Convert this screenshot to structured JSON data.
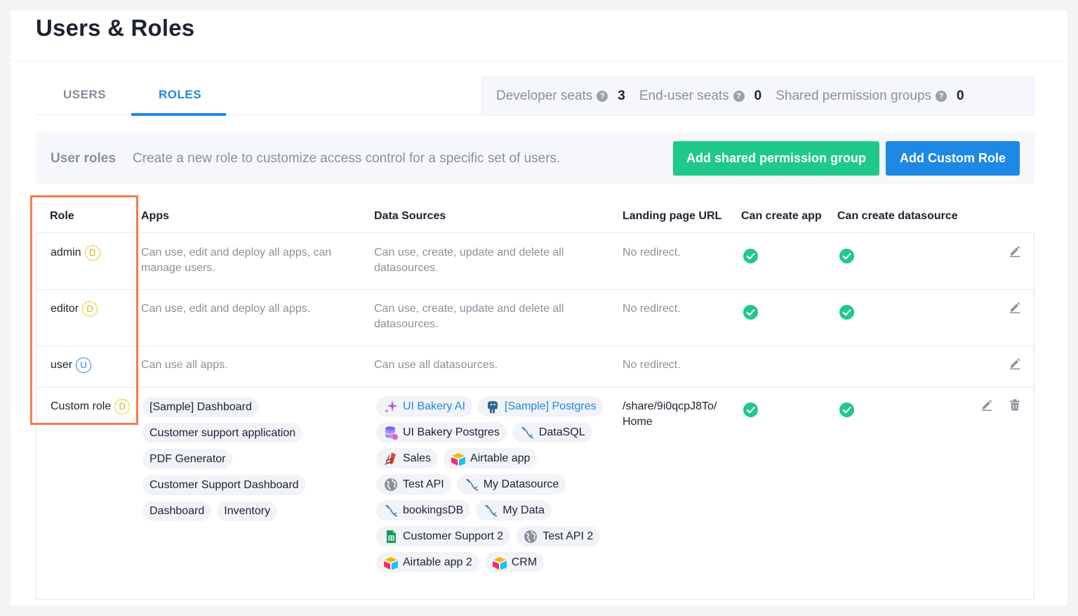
{
  "page": {
    "title": "Users & Roles"
  },
  "tabs": [
    {
      "label": "USERS",
      "active": false
    },
    {
      "label": "ROLES",
      "active": true
    }
  ],
  "seats": {
    "developer": {
      "label": "Developer seats",
      "value": "3"
    },
    "end_user": {
      "label": "End-user seats",
      "value": "0"
    },
    "shared_groups": {
      "label": "Shared permission groups",
      "value": "0"
    },
    "help_glyph": "?"
  },
  "roles_bar": {
    "title": "User roles",
    "description": "Create a new role to customize access control for a specific set of users.",
    "add_group_label": "Add shared permission group",
    "add_role_label": "Add Custom Role"
  },
  "table": {
    "headers": {
      "role": "Role",
      "apps": "Apps",
      "data_sources": "Data Sources",
      "landing": "Landing page URL",
      "can_create_app": "Can create app",
      "can_create_datasource": "Can create datasource"
    },
    "rows": [
      {
        "name": "admin",
        "badge": "D",
        "apps": "Can use, edit and deploy all apps, can manage users.",
        "data_sources": "Can use, create, update and delete all datasources.",
        "landing": "No redirect.",
        "can_create_app": true,
        "can_create_datasource": true
      },
      {
        "name": "editor",
        "badge": "D",
        "apps": "Can use, edit and deploy all apps.",
        "data_sources": "Can use, create, update and delete all datasources.",
        "landing": "No redirect.",
        "can_create_app": true,
        "can_create_datasource": true
      },
      {
        "name": "user",
        "badge": "U",
        "apps": "Can use all apps.",
        "data_sources": "Can use all datasources.",
        "landing": "No redirect.",
        "can_create_app": false,
        "can_create_datasource": false
      },
      {
        "name": "Custom role",
        "badge": "D",
        "apps_list": [
          "[Sample] Dashboard",
          "Customer support application",
          "PDF Generator",
          "Customer Support Dashboard",
          "Dashboard",
          "Inventory"
        ],
        "data_sources_list": [
          {
            "label": "UI Bakery AI",
            "icon": "ai-sparkle-icon"
          },
          {
            "label": "[Sample] Postgres",
            "icon": "postgres-icon"
          },
          {
            "label": "UI Bakery Postgres",
            "icon": "database-icon"
          },
          {
            "label": "DataSQL",
            "icon": "mysql-icon"
          },
          {
            "label": "Sales",
            "icon": "redis-icon"
          },
          {
            "label": "Airtable app",
            "icon": "airtable-icon"
          },
          {
            "label": "Test API",
            "icon": "globe-icon"
          },
          {
            "label": "My Datasource",
            "icon": "mysql-icon"
          },
          {
            "label": "bookingsDB",
            "icon": "mysql-icon"
          },
          {
            "label": "My Data",
            "icon": "mysql-icon"
          },
          {
            "label": "Customer Support 2",
            "icon": "google-sheets-icon"
          },
          {
            "label": "Test API 2",
            "icon": "globe-icon"
          },
          {
            "label": "Airtable app 2",
            "icon": "airtable-icon"
          },
          {
            "label": "CRM",
            "icon": "airtable-icon"
          }
        ],
        "landing": "/share/9i0qcpJ8To/ Home",
        "can_create_app": true,
        "can_create_datasource": true
      }
    ]
  },
  "colors": {
    "accent": "#1e88e5",
    "success": "#1ec98b",
    "highlight": "#f77b47",
    "badge_dev": "#f5c518"
  }
}
